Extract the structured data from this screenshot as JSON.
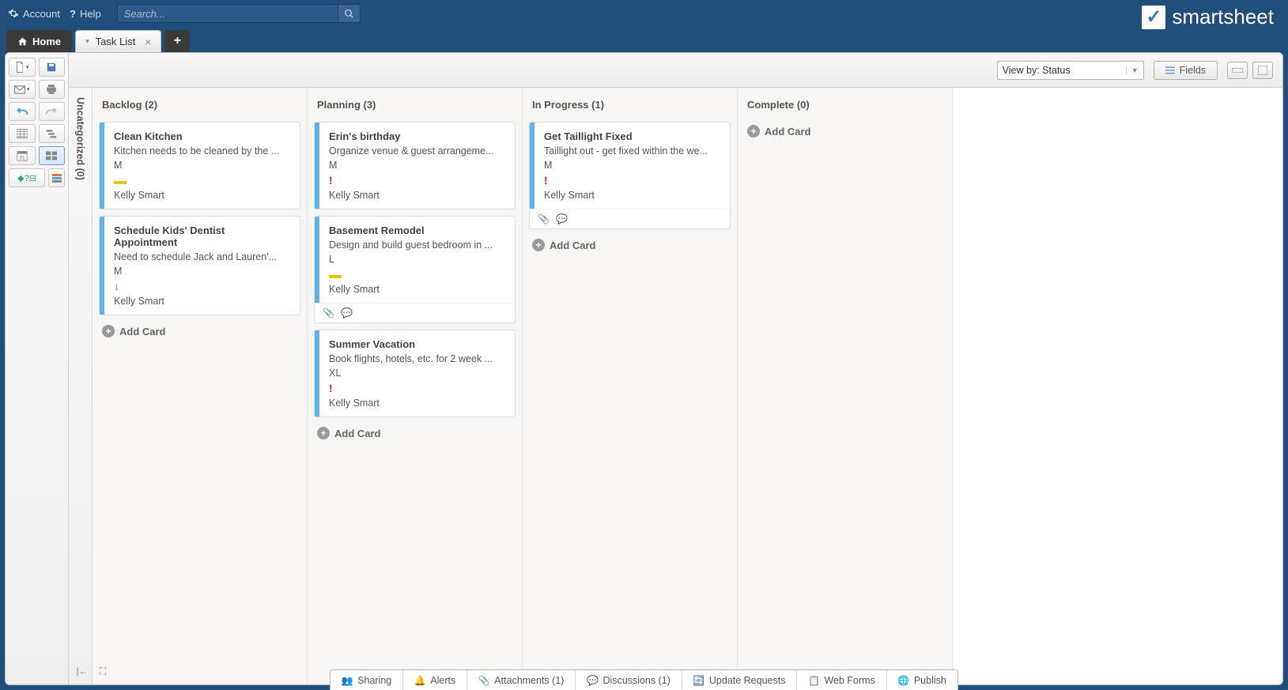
{
  "top": {
    "account_label": "Account",
    "help_label": "Help",
    "search_placeholder": "Search..."
  },
  "brand": {
    "name": "smartsheet"
  },
  "tabs": {
    "home_label": "Home",
    "sheet_label": "Task List",
    "add_label": "+"
  },
  "board_toolbar": {
    "viewby_label": "View by: Status",
    "fields_label": "Fields"
  },
  "lanes": {
    "uncategorized": {
      "title": "Uncategorized (0)"
    },
    "backlog": {
      "title": "Backlog (2)",
      "add_label": "Add Card",
      "cards": [
        {
          "title": "Clean Kitchen",
          "desc": "Kitchen needs to be cleaned by the ...",
          "size": "M",
          "priority": "med",
          "owner": "Kelly Smart"
        },
        {
          "title": "Schedule Kids' Dentist Appointment",
          "desc": "Need to schedule Jack and Lauren'...",
          "size": "M",
          "priority": "low",
          "owner": "Kelly Smart"
        }
      ]
    },
    "planning": {
      "title": "Planning (3)",
      "add_label": "Add Card",
      "cards": [
        {
          "title": "Erin's birthday",
          "desc": "Organize venue & guest arrangeme...",
          "size": "M",
          "priority": "high",
          "owner": "Kelly Smart"
        },
        {
          "title": "Basement Remodel",
          "desc": "Design and build guest bedroom in ...",
          "size": "L",
          "priority": "med",
          "owner": "Kelly Smart",
          "footer_icons": true
        },
        {
          "title": "Summer Vacation",
          "desc": "Book flights, hotels, etc. for 2 week ...",
          "size": "XL",
          "priority": "high",
          "owner": "Kelly Smart"
        }
      ]
    },
    "inprogress": {
      "title": "In Progress (1)",
      "add_label": "Add Card",
      "cards": [
        {
          "title": "Get Taillight Fixed",
          "desc": "Taillight out - get fixed within the we...",
          "size": "M",
          "priority": "high",
          "owner": "Kelly Smart",
          "footer_icons": true
        }
      ]
    },
    "complete": {
      "title": "Complete (0)",
      "add_label": "Add Card",
      "cards": []
    }
  },
  "bottom_tabs": {
    "sharing": "Sharing",
    "alerts": "Alerts",
    "attachments": "Attachments (1)",
    "discussions": "Discussions (1)",
    "update_requests": "Update Requests",
    "web_forms": "Web Forms",
    "publish": "Publish"
  }
}
